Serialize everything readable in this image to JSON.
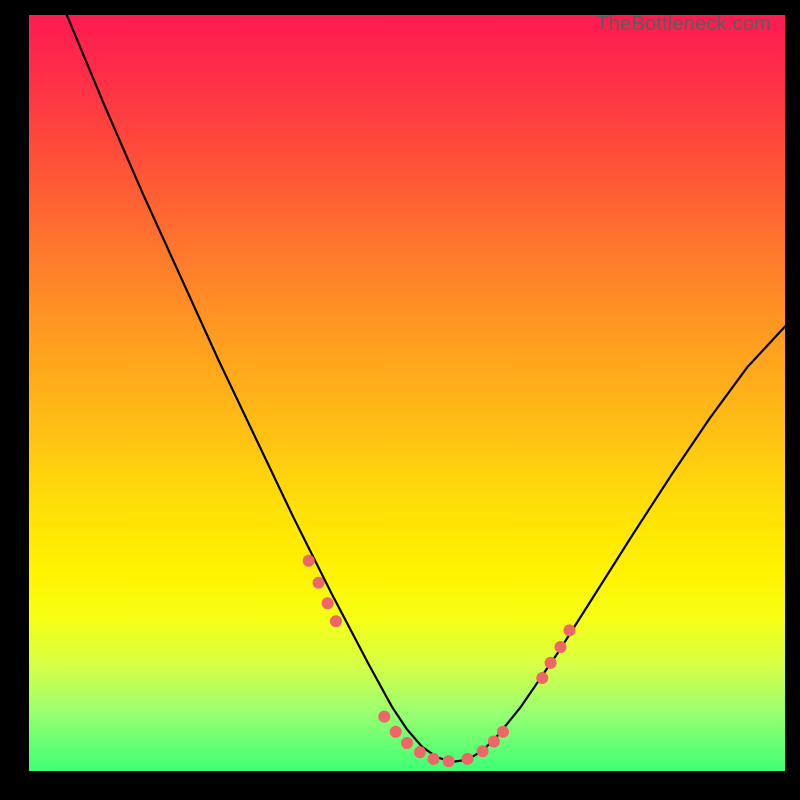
{
  "attribution": "TheBottleneck.com",
  "colors": {
    "marker_fill": "#ee6666",
    "curve_stroke": "#000000",
    "gradient_top": "#ff1a51",
    "gradient_bottom": "#3eff76",
    "page_bg": "#000000"
  },
  "chart_data": {
    "type": "line",
    "title": "",
    "xlabel": "",
    "ylabel": "",
    "xlim": [
      0,
      100
    ],
    "ylim": [
      0,
      100
    ],
    "grid": false,
    "legend": null,
    "note": "Axes have no visible tick labels; x/y are normalized 0–100 estimated from pixel positions. Curve descends from top-left, reaches a flat minimum near x≈52–58, then rises toward the right edge at roughly half-height.",
    "series": [
      {
        "name": "curve",
        "stroke": "#000000",
        "x": [
          5,
          10,
          15,
          20,
          25,
          30,
          35,
          40,
          45,
          48,
          50,
          52,
          54,
          56,
          58,
          60,
          62,
          65,
          70,
          75,
          80,
          85,
          90,
          95,
          100
        ],
        "y": [
          100,
          88,
          76.5,
          65.5,
          54.5,
          44,
          33.5,
          23.5,
          14,
          8.5,
          5.5,
          3.2,
          1.8,
          1.2,
          1.5,
          2.7,
          4.7,
          8.4,
          15.7,
          23.6,
          31.5,
          39.2,
          46.6,
          53.4,
          58.8
        ]
      }
    ],
    "markers": {
      "name": "highlighted-points",
      "fill": "#ee6666",
      "radius_px": 6,
      "x": [
        37.0,
        38.3,
        39.5,
        40.6,
        47.0,
        48.5,
        50.0,
        51.7,
        53.5,
        55.5,
        58.0,
        60.0,
        61.5,
        62.7,
        67.9,
        69.0,
        70.3,
        71.5
      ],
      "y": [
        27.8,
        24.9,
        22.2,
        19.8,
        7.2,
        5.2,
        3.7,
        2.5,
        1.6,
        1.3,
        1.6,
        2.6,
        3.9,
        5.2,
        12.3,
        14.3,
        16.4,
        18.6
      ]
    }
  }
}
